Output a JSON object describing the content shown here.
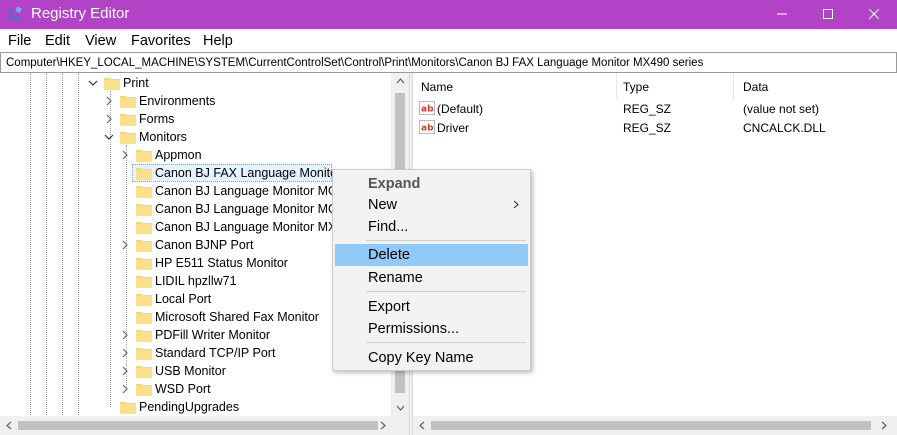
{
  "window": {
    "title": "Registry Editor",
    "accent_color": "#b243c6"
  },
  "menu": [
    "File",
    "Edit",
    "View",
    "Favorites",
    "Help"
  ],
  "address": "Computer\\HKEY_LOCAL_MACHINE\\SYSTEM\\CurrentControlSet\\Control\\Print\\Monitors\\Canon BJ FAX Language Monitor MX490 series",
  "tree": {
    "print": "Print",
    "environments": "Environments",
    "forms": "Forms",
    "monitors": "Monitors",
    "monitor_items": [
      "Appmon",
      "Canon BJ FAX Language Monitor",
      "Canon BJ Language Monitor MG2",
      "Canon BJ Language Monitor MG2",
      "Canon BJ Language Monitor MX4",
      "Canon BJNP Port",
      "HP E511 Status Monitor",
      "LIDIL hpzllw71",
      "Local Port",
      "Microsoft Shared Fax Monitor",
      "PDFill Writer Monitor",
      "Standard TCP/IP Port",
      "USB Monitor",
      "WSD Port"
    ],
    "pending": "PendingUpgrades"
  },
  "list": {
    "headers": {
      "name": "Name",
      "type": "Type",
      "data": "Data"
    },
    "rows": [
      {
        "name": "(Default)",
        "type": "REG_SZ",
        "data": "(value not set)"
      },
      {
        "name": "Driver",
        "type": "REG_SZ",
        "data": "CNCALCK.DLL"
      }
    ]
  },
  "context_menu": {
    "expand": "Expand",
    "new": "New",
    "find": "Find...",
    "delete": "Delete",
    "rename": "Rename",
    "export": "Export",
    "permissions": "Permissions...",
    "copy_key_name": "Copy Key Name",
    "highlight_color": "#91c9f7"
  }
}
